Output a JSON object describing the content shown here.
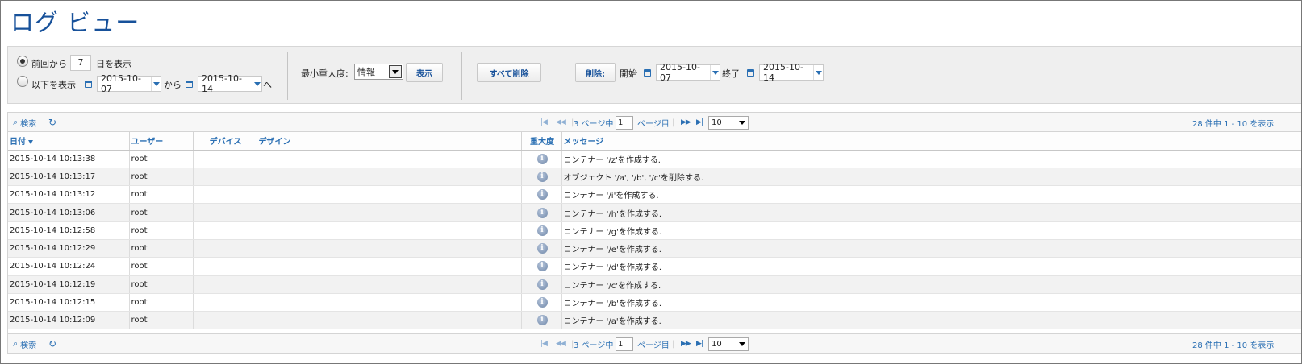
{
  "page": {
    "title": "ログ ビュー"
  },
  "filter": {
    "recent_prefix": "前回から",
    "recent_days": "7",
    "recent_suffix": "日を表示",
    "range_label": "以下を表示",
    "range_from": "2015-10-07",
    "range_from_suffix": "から",
    "range_to": "2015-10-14",
    "range_to_suffix": "へ",
    "min_severity_label": "最小重大度:",
    "min_severity_value": "情報",
    "show_button": "表示",
    "delete_all_button": "すべて削除",
    "delete_button": "削除:",
    "delete_start_label": "開始",
    "delete_start": "2015-10-07",
    "delete_end_label": "終了",
    "delete_end": "2015-10-14"
  },
  "pager": {
    "search_label": "検索",
    "page_prefix": "3 ページ中",
    "page_value": "1",
    "page_suffix": "ページ目",
    "per_page": "10",
    "summary": "28 件中 1 - 10 を表示"
  },
  "table": {
    "columns": [
      "日付",
      "ユーザー",
      "デバイス",
      "デザイン",
      "重大度",
      "メッセージ"
    ],
    "rows": [
      {
        "date": "2015-10-14 10:13:38",
        "user": "root",
        "device": "",
        "design": "",
        "severity": "info",
        "message": "コンテナー '/z'を作成する."
      },
      {
        "date": "2015-10-14 10:13:17",
        "user": "root",
        "device": "",
        "design": "",
        "severity": "info",
        "message": "オブジェクト '/a', '/b', '/c'を削除する."
      },
      {
        "date": "2015-10-14 10:13:12",
        "user": "root",
        "device": "",
        "design": "",
        "severity": "info",
        "message": "コンテナー '/i'を作成する."
      },
      {
        "date": "2015-10-14 10:13:06",
        "user": "root",
        "device": "",
        "design": "",
        "severity": "info",
        "message": "コンテナー '/h'を作成する."
      },
      {
        "date": "2015-10-14 10:12:58",
        "user": "root",
        "device": "",
        "design": "",
        "severity": "info",
        "message": "コンテナー '/g'を作成する."
      },
      {
        "date": "2015-10-14 10:12:29",
        "user": "root",
        "device": "",
        "design": "",
        "severity": "info",
        "message": "コンテナー '/e'を作成する."
      },
      {
        "date": "2015-10-14 10:12:24",
        "user": "root",
        "device": "",
        "design": "",
        "severity": "info",
        "message": "コンテナー '/d'を作成する."
      },
      {
        "date": "2015-10-14 10:12:19",
        "user": "root",
        "device": "",
        "design": "",
        "severity": "info",
        "message": "コンテナー '/c'を作成する."
      },
      {
        "date": "2015-10-14 10:12:15",
        "user": "root",
        "device": "",
        "design": "",
        "severity": "info",
        "message": "コンテナー '/b'を作成する."
      },
      {
        "date": "2015-10-14 10:12:09",
        "user": "root",
        "device": "",
        "design": "",
        "severity": "info",
        "message": "コンテナー '/a'を作成する."
      }
    ]
  },
  "colors": {
    "accent": "#17519a",
    "link": "#2a6fb3",
    "filter_bg": "#efefef",
    "row_alt": "#f2f2f2"
  }
}
